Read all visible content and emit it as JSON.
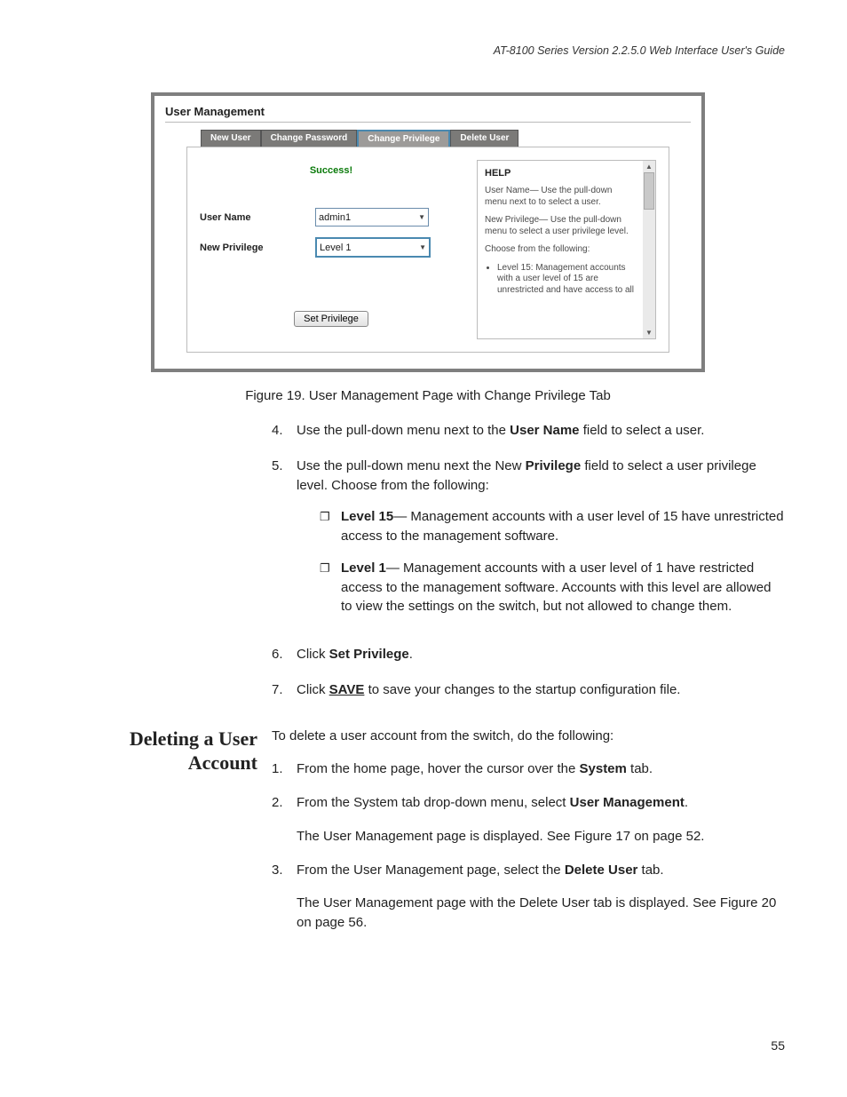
{
  "header": {
    "running": "AT-8100 Series Version 2.2.5.0 Web Interface User's Guide"
  },
  "page_number": "55",
  "shot": {
    "title": "User Management",
    "tabs": {
      "new_user": "New User",
      "change_password": "Change Password",
      "change_privilege": "Change Privilege",
      "delete_user": "Delete User"
    },
    "success": "Success!",
    "labels": {
      "user_name": "User Name",
      "new_privilege": "New Privilege"
    },
    "values": {
      "user_name": "admin1",
      "new_privilege": "Level 1"
    },
    "button": "Set Privilege",
    "help": {
      "heading": "HELP",
      "p1": "User Name— Use the pull-down menu next to to select a user.",
      "p2": "New Privilege— Use the pull-down menu to select a user privilege level.",
      "p3": "Choose from the following:",
      "li1": "Level 15: Management accounts with a user level of 15 are unrestricted and have access to all"
    }
  },
  "caption": "Figure 19. User Management Page with Change Privilege Tab",
  "steps": {
    "s4": {
      "pre": "Use the pull-down menu next to the ",
      "bold": "User Name",
      "post": " field to select a user."
    },
    "s5": {
      "pre": "Use the pull-down menu next the New ",
      "bold": "Privilege",
      "post": " field to select a user privilege level. Choose from the following:"
    },
    "s5a": {
      "bold": "Level 15",
      "rest": "— Management accounts with a user level of 15 have unrestricted access to the management software."
    },
    "s5b": {
      "bold": "Level 1",
      "rest": "— Management accounts with a user level of 1 have restricted access to the management software. Accounts with this level are allowed to view the settings on the switch, but not allowed to change them."
    },
    "s6": {
      "pre": "Click ",
      "bold": "Set Privilege",
      "post": "."
    },
    "s7": {
      "pre": "Click ",
      "bold": "SAVE",
      "post": " to save your changes to the startup configuration file."
    }
  },
  "section2": {
    "heading_l1": "Deleting a User",
    "heading_l2": "Account",
    "intro": "To delete a user account from the switch, do the following:",
    "s1": {
      "pre": "From the home page, hover the cursor over the ",
      "bold": "System",
      "post": " tab."
    },
    "s2": {
      "pre": "From the System tab drop-down menu, select ",
      "bold": "User Management",
      "post": "."
    },
    "note2": "The User Management page is displayed. See Figure 17 on page 52.",
    "s3": {
      "pre": "From the User Management page, select the ",
      "bold": "Delete User",
      "post": " tab."
    },
    "note3": "The User Management page with the Delete User tab is displayed. See Figure 20 on page 56."
  }
}
